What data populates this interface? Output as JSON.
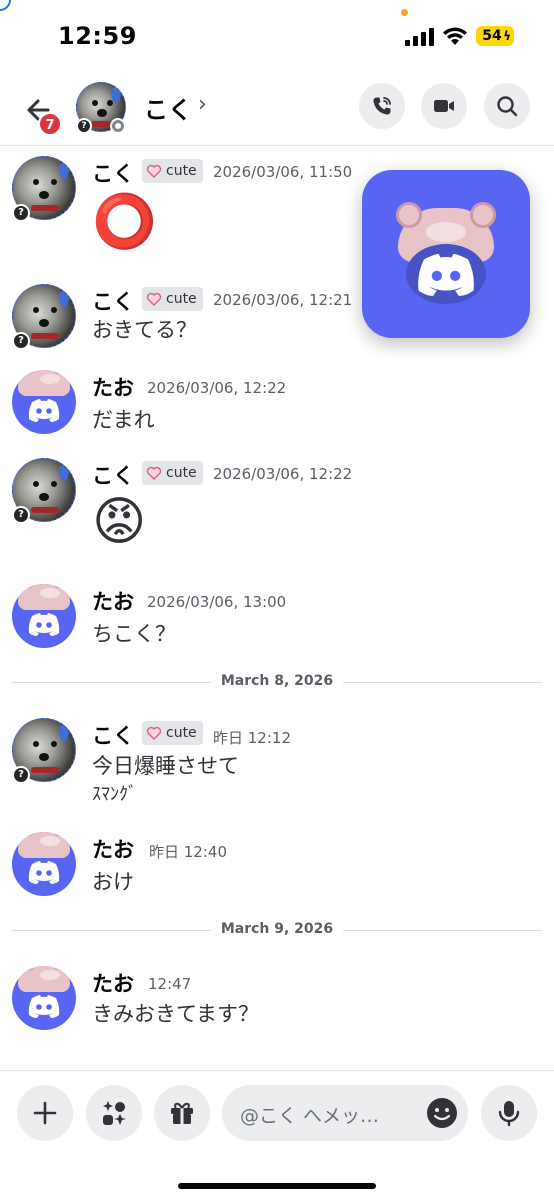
{
  "status_bar": {
    "time": "12:59",
    "battery": "54"
  },
  "header": {
    "back_badge": "7",
    "name": "こく",
    "chevron": "›"
  },
  "messages": [
    {
      "author": "こく",
      "tag": "cute",
      "time": "2026/03/06, 11:50",
      "text": "⭕"
    },
    {
      "author": "こく",
      "tag": "cute",
      "time": "2026/03/06, 12:21",
      "text": "おきてる？"
    },
    {
      "author": "たお",
      "time": "2026/03/06, 12:22",
      "text": "だまれ"
    },
    {
      "author": "こく",
      "tag": "cute",
      "time": "2026/03/06, 12:22",
      "text": "😡"
    },
    {
      "author": "たお",
      "time": "2026/03/06, 13:00",
      "text": "ちこく？"
    },
    {
      "author": "こく",
      "tag": "cute",
      "time": "昨日 12:12",
      "text": "今日爆睡させて",
      "text2": "ｽﾏﾝｸﾞ"
    },
    {
      "author": "たお",
      "time": "昨日 12:40",
      "text": "おけ"
    },
    {
      "author": "たお",
      "time": "12:47",
      "text": "きみおきてます？"
    }
  ],
  "dividers": [
    "March 8, 2026",
    "March 9, 2026"
  ],
  "composer": {
    "placeholder": "@こく へメッ…"
  },
  "colors": {
    "blurple": "#5865f2",
    "badge_red": "#da373c",
    "battery_yellow": "#ffd60a"
  },
  "icons": [
    "back-arrow-icon",
    "phone-call-icon",
    "video-camera-icon",
    "search-icon",
    "plus-icon",
    "apps-icon",
    "gift-icon",
    "emoji-icon",
    "microphone-icon",
    "discord-logo-icon",
    "heart-icon"
  ]
}
